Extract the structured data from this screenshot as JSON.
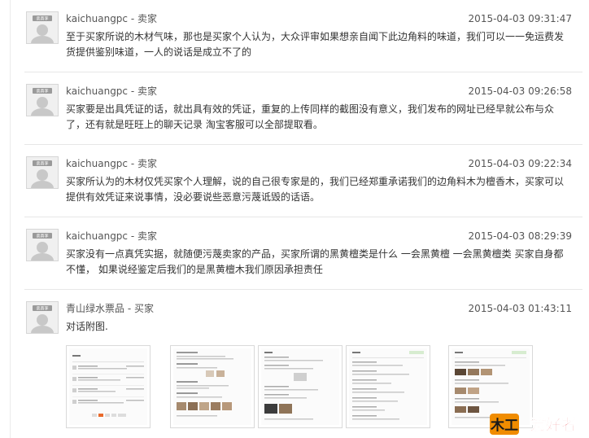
{
  "entries": [
    {
      "author": "kaichuangpc - 卖家",
      "time": "2015-04-03 09:31:47",
      "lines": [
        "至于买家所说的木材气味，那也是买家个人认为，大众评审如果想亲自闻下此边角料的味道，我们可以一一免运费发",
        "货提供鉴别味道，一人的说话是成立不了的"
      ]
    },
    {
      "author": "kaichuangpc - 卖家",
      "time": "2015-04-03 09:26:58",
      "lines": [
        "买家要是出具凭证的话，就出具有效的凭证，重复的上传同样的截图没有意义，我们发布的网址已经早就公布与众",
        "了，还有就是旺旺上的聊天记录 淘宝客服可以全部提取看。"
      ]
    },
    {
      "author": "kaichuangpc - 卖家",
      "time": "2015-04-03 09:22:34",
      "lines": [
        "买家所认为的木材仅凭买家个人理解，说的自己很专家是的，我们已经郑重承诺我们的边角料木为檀香木，买家可以",
        "提供有效凭证来说事情，没必要说些恶意污蔑诋毁的话语。"
      ]
    },
    {
      "author": "kaichuangpc - 卖家",
      "time": "2015-04-03 08:29:39",
      "lines": [
        "买家没有一点真凭实据，就随便污蔑卖家的产品，买家所谓的黑黄檀类是什么 一会黑黄檀 一会黑黄檀类 买家自身都",
        "不懂，  如果说经鉴定后我们的是黑黄檀木我们原因承担责任"
      ]
    },
    {
      "author": "青山绿水票品 - 买家",
      "time": "2015-04-03 01:43:11",
      "lines": [
        "对话附图."
      ]
    }
  ],
  "avatar_label": "卖真李",
  "attachments_count": 5,
  "logo": {
    "part1": "木工",
    "part2": "爱好者"
  },
  "colors": {
    "text": "#333333",
    "meta": "#555555",
    "separator": "#e7e7e7",
    "logo_orange": "#f08c00",
    "logo_red": "#e3262b"
  }
}
